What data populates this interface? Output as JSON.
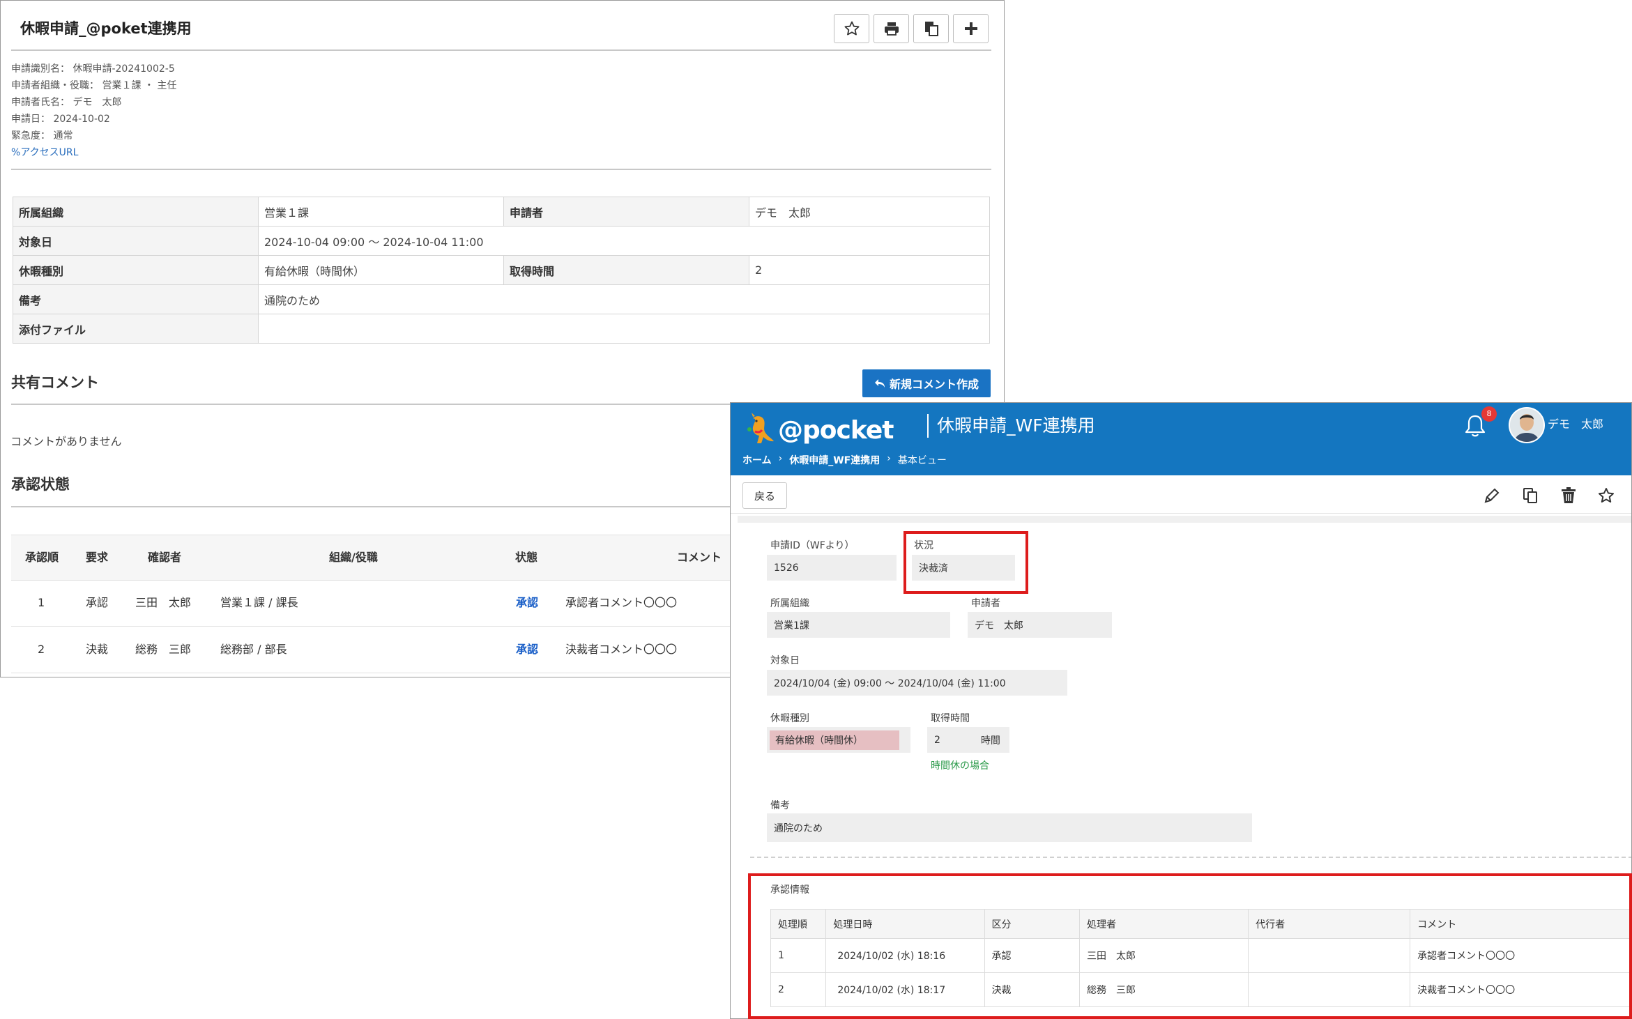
{
  "left_window": {
    "title": "休暇申請_@poket連携用",
    "toolbar": [
      {
        "icon": "star-outline-icon"
      },
      {
        "icon": "print-icon"
      },
      {
        "icon": "copy-icon"
      },
      {
        "icon": "plus-icon"
      }
    ],
    "meta": {
      "id_label": "申請識別名：",
      "id_value": "休暇申請-20241002-5",
      "org_label": "申請者組織・役職：",
      "org_value": "営業１課 ・ 主任",
      "name_label": "申請者氏名：",
      "name_value": "デモ　太郎",
      "date_label": "申請日：",
      "date_value": "2024-10-02",
      "urgency_label": "緊急度：",
      "urgency_value": "通常",
      "access_url": "アクセスURL"
    },
    "form_table": {
      "r1": {
        "l1": "所属組織",
        "v1": "営業１課",
        "l2": "申請者",
        "v2": "デモ　太郎"
      },
      "r2": {
        "l1": "対象日",
        "v1": "2024-10-04 09:00 ～ 2024-10-04 11:00"
      },
      "r3": {
        "l1": "休暇種別",
        "v1": "有給休暇（時間休）",
        "l2": "取得時間",
        "v2": "2"
      },
      "r4": {
        "l1": "備考",
        "v1": "通院のため"
      },
      "r5": {
        "l1": "添付ファイル",
        "v1": ""
      }
    },
    "comments": {
      "title": "共有コメント",
      "new_button": "新規コメント作成",
      "empty": "コメントがありません"
    },
    "approval": {
      "title": "承認状態",
      "headers": {
        "order": "承認順",
        "req": "要求",
        "approver": "確認者",
        "org": "組織/役職",
        "status": "状態",
        "comment": "コメント"
      },
      "rows": [
        {
          "order": "1",
          "req": "承認",
          "approver": "三田　太郎",
          "org": "営業１課 / 課長",
          "status": "承認",
          "comment": "承認者コメント〇〇〇"
        },
        {
          "order": "2",
          "req": "決裁",
          "approver": "総務　三郎",
          "org": "総務部 / 部長",
          "status": "承認",
          "comment": "決裁者コメント〇〇〇"
        }
      ]
    }
  },
  "right_window": {
    "logo": "@pocket",
    "app_name": "休暇申請_WF連携用",
    "breadcrumb": {
      "home": "ホーム",
      "app": "休暇申請_WF連携用",
      "view": "基本ビュー"
    },
    "notification_count": "8",
    "user_name": "デモ　太郎",
    "back_button": "戻る",
    "fields": {
      "request_id_label": "申請ID（WFより）",
      "request_id_value": "1526",
      "status_label": "状況",
      "status_value": "決裁済",
      "org_label": "所属組織",
      "org_value": "営業1課",
      "applicant_label": "申請者",
      "applicant_value": "デモ　太郎",
      "target_label": "対象日",
      "target_value": "2024/10/04 (金) 09:00 ～ 2024/10/04 (金) 11:00",
      "type_label": "休暇種別",
      "type_value": "有給休暇（時間休）",
      "hours_label": "取得時間",
      "hours_value": "2",
      "hours_unit": "時間",
      "hours_hint": "時間休の場合",
      "note_label": "備考",
      "note_value": "通院のため"
    },
    "approval_info": {
      "title": "承認情報",
      "headers": {
        "order": "処理順",
        "datetime": "処理日時",
        "kind": "区分",
        "processor": "処理者",
        "proxy": "代行者",
        "comment": "コメント"
      },
      "rows": [
        {
          "order": "1",
          "datetime": "2024/10/02 (水) 18:16",
          "kind": "承認",
          "processor": "三田　太郎",
          "proxy": "",
          "comment": "承認者コメント〇〇〇"
        },
        {
          "order": "2",
          "datetime": "2024/10/02 (水) 18:17",
          "kind": "決裁",
          "processor": "総務　三郎",
          "proxy": "",
          "comment": "決裁者コメント〇〇〇"
        }
      ]
    },
    "highlight_color": "#dd1c1c",
    "header_color": "#1476c0"
  }
}
